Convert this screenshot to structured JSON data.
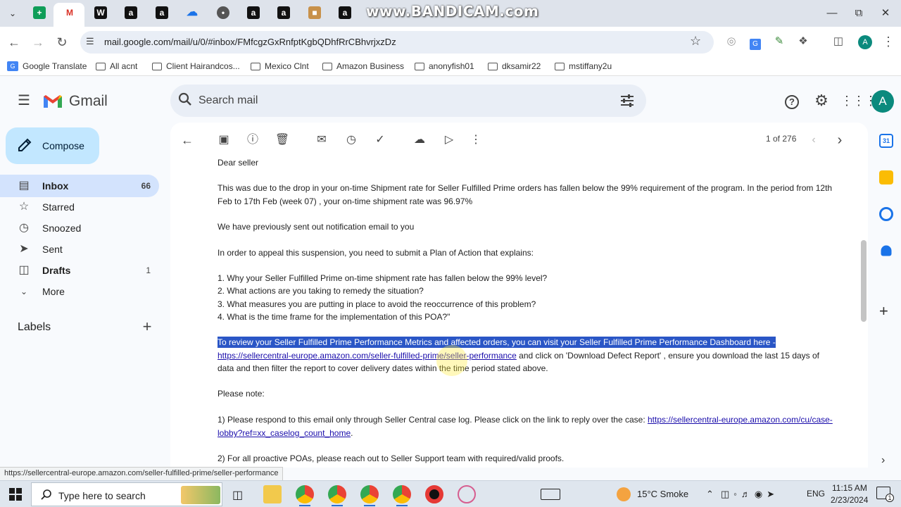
{
  "browser": {
    "watermark": "www.BANDICAM.com",
    "url": "mail.google.com/mail/u/0/#inbox/FMfcgzGxRnfptKgbQDhfRrCBhvrjxzDz",
    "profile_initial": "A",
    "bookmarks": [
      "Google Translate",
      "All acnt",
      "Client Hairandcos...",
      "Mexico Clnt",
      "Amazon Business",
      "anonyfish01",
      "dksamir22",
      "mstiffany2u"
    ]
  },
  "gmail": {
    "logo_text": "Gmail",
    "search_placeholder": "Search mail",
    "account_initial": "A",
    "compose_label": "Compose",
    "nav": [
      {
        "label": "Inbox",
        "count": "66",
        "icon": "inbox-icon"
      },
      {
        "label": "Starred",
        "count": "",
        "icon": "star-icon"
      },
      {
        "label": "Snoozed",
        "count": "",
        "icon": "clock-icon"
      },
      {
        "label": "Sent",
        "count": "",
        "icon": "send-icon"
      },
      {
        "label": "Drafts",
        "count": "1",
        "icon": "draft-icon"
      },
      {
        "label": "More",
        "count": "",
        "icon": "chevron-down-icon"
      }
    ],
    "labels_heading": "Labels",
    "pager": "1 of 276"
  },
  "email": {
    "greeting": "Dear seller",
    "para1_line1": "This was due to the drop in your on-time Shipment rate for Seller Fulfilled Prime orders has fallen below the 99% requirement of the program. In the period from 12th",
    "para1_line2": "Feb to 17th Feb (week 07) , your on-time shipment rate was 96.97%",
    "para2": "We have previously sent out notification email to you",
    "para3": "In order to appeal this suspension, you need to submit a Plan of Action that explains:",
    "q1": "1. Why your Seller Fulfilled Prime on-time shipment rate has fallen below the 99% level?",
    "q2": "2. What actions are you taking to remedy the situation?",
    "q3": "3. What measures you are putting in place to avoid the reoccurrence of this problem?",
    "q4": "4.  What is the time frame for the implementation of this POA?\"",
    "review_highlight": "To review your Seller Fulfilled Prime Performance Metrics and affected orders, you can visit your Seller Fulfilled Prime Performance Dashboard here -",
    "review_link": "https://sellercentral-europe.amazon.com/seller-fulfilled-prime/seller-performance",
    "review_after_link": " and click on 'Download Defect Report' , ensure you download the last 15 days of",
    "review_line3": "data and then filter the report to cover delivery dates within the time period stated above.",
    "please_note": "Please note:",
    "note1_text": "1) Please respond to this email only through Seller Central case log. Please click on the link to reply over the case: ",
    "note1_link_a": "https://sellercentral-europe.amazon.com/cu/case-",
    "note1_link_b": "lobby?ref=xx_caselog_count_home",
    "note1_end": ".",
    "note2": "2) For all proactive POAs, please reach out to Seller Support team with required/valid proofs."
  },
  "status_url": "https://sellercentral-europe.amazon.com/seller-fulfilled-prime/seller-performance",
  "taskbar": {
    "search_placeholder": "Type here to search",
    "weather": "15°C  Smoke",
    "lang": "ENG",
    "time": "11:15 AM",
    "date": "2/23/2024",
    "notif_count": "1"
  }
}
